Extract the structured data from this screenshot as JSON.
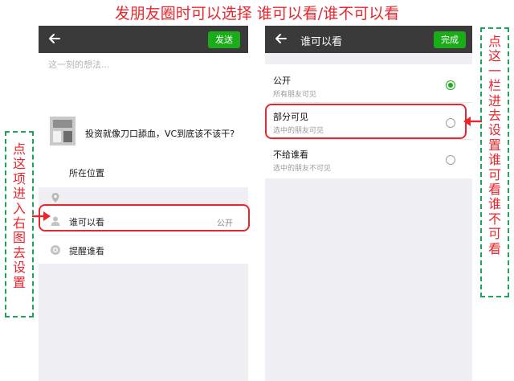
{
  "headline": "发朋友圈时可以选择 谁可以看/谁不可以看",
  "left_phone": {
    "send_button": "发送",
    "placeholder": "这一刻的想法...",
    "link_title": "投资就像刀口舔血，VC到底该不该干?",
    "location_label": "所在位置",
    "visibility_label": "谁可以看",
    "visibility_value": "公开",
    "mention_label": "提醒谁看"
  },
  "right_phone": {
    "title": "谁可以看",
    "done_button": "完成",
    "options": [
      {
        "title": "公开",
        "subtitle": "所有朋友可见",
        "selected": true
      },
      {
        "title": "部分可见",
        "subtitle": "选中的朋友可见",
        "selected": false
      },
      {
        "title": "不给谁看",
        "subtitle": "选中的朋友不可见",
        "selected": false
      }
    ]
  },
  "left_annotation": [
    "点",
    "这",
    "项",
    "进",
    "入",
    "右",
    "图",
    "去",
    "设",
    "置"
  ],
  "right_annotation": [
    "点",
    "这",
    "一",
    "栏",
    "进",
    "去",
    "设",
    "置",
    "谁",
    "可",
    "看",
    "谁",
    "不",
    "可",
    "看"
  ],
  "colors": {
    "accent_green": "#1aad19",
    "highlight_red": "#e8262e",
    "dark_bar": "#3a3a3a",
    "dashed_box_green": "#1fa35a"
  }
}
